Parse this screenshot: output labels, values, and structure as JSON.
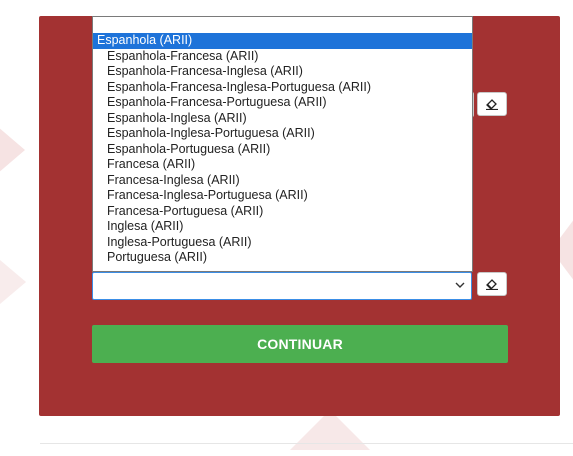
{
  "form": {
    "dropdown_options": [
      "Espanhola (ARII)",
      "Espanhola-Francesa (ARII)",
      "Espanhola-Francesa-Inglesa (ARII)",
      "Espanhola-Francesa-Inglesa-Portuguesa (ARII)",
      "Espanhola-Francesa-Portuguesa (ARII)",
      "Espanhola-Inglesa (ARII)",
      "Espanhola-Inglesa-Portuguesa (ARII)",
      "Espanhola-Portuguesa (ARII)",
      "Francesa (ARII)",
      "Francesa-Inglesa (ARII)",
      "Francesa-Inglesa-Portuguesa (ARII)",
      "Francesa-Portuguesa (ARII)",
      "Inglesa (ARII)",
      "Inglesa-Portuguesa (ARII)",
      "Portuguesa (ARII)"
    ],
    "selected_option": "Espanhola (ARII)",
    "select_value": "",
    "continue_label": "CONTINUAR"
  },
  "colors": {
    "panel_bg": "#a33232",
    "continue_bg": "#4caf50",
    "highlight": "#1e73d9"
  },
  "icons": {
    "clear": "eraser-icon",
    "select_arrow": "chevron-down-icon"
  }
}
